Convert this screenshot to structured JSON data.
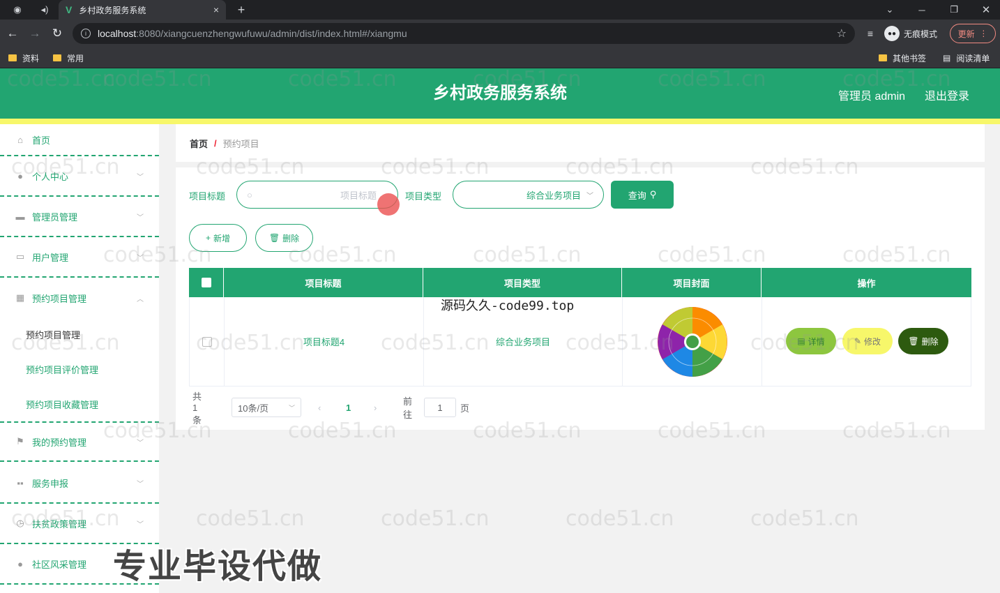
{
  "browser": {
    "tab_title": "乡村政务服务系统",
    "tab_close": "×",
    "new_tab": "+",
    "url_host": "localhost",
    "url_path": ":8080/xiangcuenzhengwufuwu/admin/dist/index.html#/xiangmu",
    "incognito_label": "无痕模式",
    "update_label": "更新",
    "bookmarks": [
      "资料",
      "常用"
    ],
    "bookmarks_right": [
      "其他书签",
      "阅读清单"
    ]
  },
  "header": {
    "title": "乡村政务服务系统",
    "admin_label": "管理员 admin",
    "logout_label": "退出登录"
  },
  "sidebar": {
    "items": [
      {
        "label": "首页",
        "icon": "home-icon"
      },
      {
        "label": "个人中心",
        "icon": "user-icon"
      },
      {
        "label": "管理员管理",
        "icon": "briefcase-icon"
      },
      {
        "label": "用户管理",
        "icon": "chat-icon"
      },
      {
        "label": "预约项目管理",
        "icon": "grid-icon"
      },
      {
        "label": "我的预约管理",
        "icon": "flag-icon"
      },
      {
        "label": "服务申报",
        "icon": "message-icon"
      },
      {
        "label": "扶贫政策管理",
        "icon": "clock-icon"
      },
      {
        "label": "社区风采管理",
        "icon": "user-icon"
      }
    ],
    "submenu": [
      "预约项目管理",
      "预约项目评价管理",
      "预约项目收藏管理"
    ]
  },
  "breadcrumb": {
    "home": "首页",
    "separator": "/",
    "current": "预约项目"
  },
  "search": {
    "title_label": "项目标题",
    "title_placeholder": "项目标题",
    "type_label": "项目类型",
    "type_value": "综合业务项目",
    "query_button": "查询"
  },
  "actions": {
    "add": "新增",
    "delete": "删除"
  },
  "table": {
    "headers": [
      "项目标题",
      "项目类型",
      "项目封面",
      "操作"
    ],
    "rows": [
      {
        "title": "项目标题4",
        "type": "综合业务项目"
      }
    ],
    "row_actions": {
      "detail": "详情",
      "edit": "修改",
      "delete": "删除"
    }
  },
  "pagination": {
    "total": "共 1 条",
    "page_size": "10条/页",
    "current_page": "1",
    "goto_label": "前往",
    "goto_value": "1",
    "page_suffix": "页"
  },
  "watermarks": {
    "repeat": "code51.cn",
    "site": "源码久久-code99.top",
    "promo": "专业毕设代做"
  },
  "colors": {
    "primary": "#22a571",
    "stripe": "#f7f76a",
    "detail": "#8dc63f",
    "edit": "#f7f76a",
    "delete": "#2d5a0f"
  }
}
